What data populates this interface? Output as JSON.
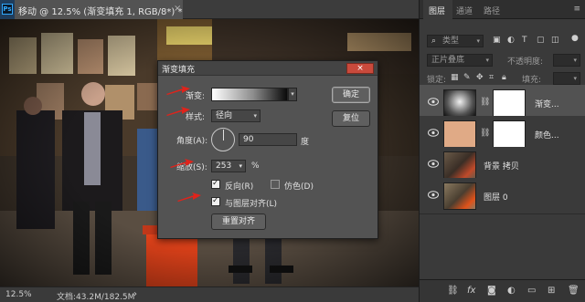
{
  "document": {
    "tab_title": "移动 @ 12.5% (渐变填充 1, RGB/8*) *",
    "close": "×",
    "ps_logo": "Ps"
  },
  "status": {
    "zoom": "12.5%",
    "docinfo": "文档:43.2M/182.5M",
    "arrow": "›"
  },
  "dialog": {
    "title": "渐变填充",
    "close": "×",
    "gradient_label": "渐变:",
    "style_label": "样式:",
    "style_value": "径向",
    "angle_label": "角度(A):",
    "angle_value": "90",
    "angle_unit": "度",
    "scale_label": "缩放(S):",
    "scale_value": "253",
    "scale_unit": "%",
    "reverse_label": "反向(R)",
    "reverse_checked": true,
    "dither_label": "仿色(D)",
    "dither_checked": false,
    "align_label": "与图层对齐(L)",
    "align_checked": true,
    "reset_align": "重置对齐",
    "ok": "确定",
    "cancel": "复位"
  },
  "panel": {
    "tabs": [
      "图层",
      "通道",
      "路径"
    ],
    "menu": "≡",
    "filter_kind": "类型",
    "blend_mode": "正片叠底",
    "opacity_label": "不透明度:",
    "lock_label": "锁定:",
    "fill_label": "填充:",
    "layers": [
      {
        "name": "渐变...",
        "selected": true
      },
      {
        "name": "颜色...",
        "selected": false
      },
      {
        "name": "背景 拷贝",
        "selected": false
      },
      {
        "name": "图层 0",
        "selected": false
      }
    ],
    "bottom_icons": [
      "link-icon",
      "fx-icon",
      "mask-icon",
      "adjustment-icon",
      "group-icon",
      "new-layer-icon",
      "trash-icon"
    ],
    "bottom_fx": "fx"
  },
  "colors": {
    "accent_blue": "#31a8ff",
    "red_arrow": "#e0231b",
    "color_fill": "#e0aa86"
  }
}
